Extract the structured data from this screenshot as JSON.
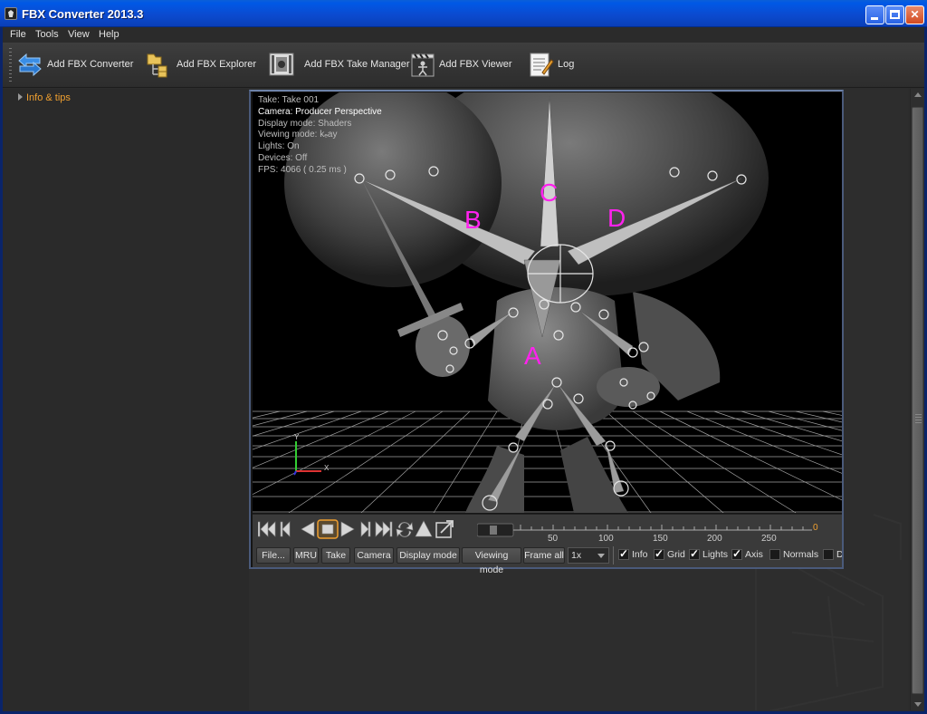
{
  "window": {
    "title": "FBX Converter 2013.3",
    "close_glyph": "✕"
  },
  "menu": [
    {
      "label": "File"
    },
    {
      "label": "Tools"
    },
    {
      "label": "View"
    },
    {
      "label": "Help"
    }
  ],
  "toolbar": {
    "items": [
      {
        "label": "Add FBX Converter",
        "icon": "converter-arrows-icon"
      },
      {
        "label": "Add FBX Explorer",
        "icon": "folder-tree-icon"
      },
      {
        "label": "Add FBX Take Manager",
        "icon": "film-strip-icon"
      },
      {
        "label": "Add FBX Viewer",
        "icon": "clapperboard-icon"
      },
      {
        "label": "Log",
        "icon": "log-notepad-icon"
      }
    ]
  },
  "sidebar": {
    "items": [
      {
        "label": "Info & tips"
      }
    ]
  },
  "viewer": {
    "hud": {
      "take": "Take: Take 001",
      "camera": "Camera: Producer Perspective",
      "display_mode": "Display mode: Shaders",
      "viewing_mode": "Viewing mode:",
      "viewing_mode_value": "kₑay",
      "lights": "Lights: On",
      "devices": "Devices: Off",
      "fps": "FPS: 4066 ( 0.25 ms )"
    },
    "annotations": {
      "a": "A",
      "b": "B",
      "c": "C",
      "d": "D"
    },
    "axis_labels": {
      "y": "Y",
      "x": "X"
    },
    "accent_color": "#ff22ee",
    "timeline": {
      "current_frame": "0",
      "ticks": [
        "50",
        "100",
        "150",
        "200",
        "250"
      ]
    },
    "buttons": {
      "file": "File...",
      "mru": "MRU",
      "take": "Take",
      "camera": "Camera",
      "display_mode": "Display mode",
      "viewing_mode": "Viewing mode",
      "frame_all": "Frame all",
      "speed": "1x"
    },
    "toggles": [
      {
        "label": "Info",
        "checked": true
      },
      {
        "label": "Grid",
        "checked": true
      },
      {
        "label": "Lights",
        "checked": true
      },
      {
        "label": "Axis",
        "checked": true
      },
      {
        "label": "Normals",
        "checked": false
      },
      {
        "label": "D",
        "checked": false
      }
    ]
  }
}
